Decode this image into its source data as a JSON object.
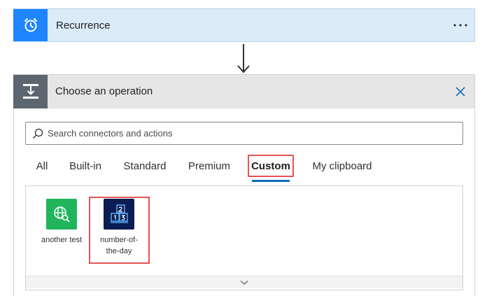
{
  "trigger": {
    "title": "Recurrence",
    "icon": "alarm-clock-icon",
    "accent_color": "#1f85ff",
    "more_icon": "ellipsis-icon"
  },
  "operation": {
    "title": "Choose an operation",
    "icon": "operation-icon",
    "close_icon": "close-icon",
    "search": {
      "placeholder": "Search connectors and actions",
      "value": ""
    },
    "tabs": [
      {
        "label": "All",
        "active": false
      },
      {
        "label": "Built-in",
        "active": false
      },
      {
        "label": "Standard",
        "active": false
      },
      {
        "label": "Premium",
        "active": false
      },
      {
        "label": "Custom",
        "active": true
      },
      {
        "label": "My clipboard",
        "active": false
      }
    ],
    "connectors": [
      {
        "label": "another test",
        "icon": "globe-search-icon",
        "color": "#21b55b"
      },
      {
        "label": "number-of-the-day",
        "label_lines": [
          "number-of-",
          "the-day"
        ],
        "icon": "number-blocks-icon",
        "color": "#0b1d51"
      }
    ],
    "expand_icon": "chevron-down-icon",
    "highlight_color": "#e55353"
  }
}
